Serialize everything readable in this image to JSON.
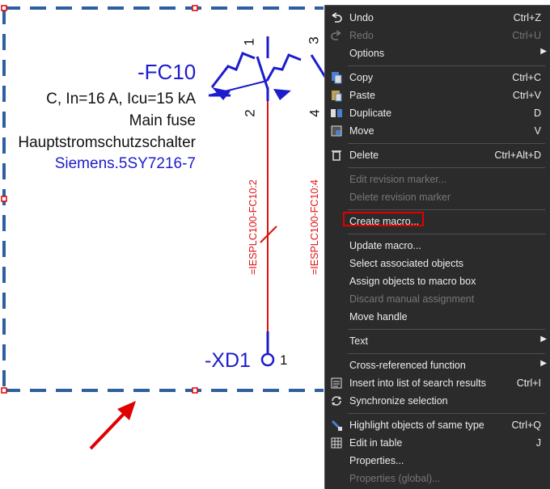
{
  "schematic": {
    "device_tag": "-FC10",
    "properties": [
      "C, In=16 A, Icu=15 kA",
      "Main fuse",
      "Hauptstromschutzschalter"
    ],
    "part_number": "Siemens.5SY7216-7",
    "terminal_tag": "-XD1",
    "terminal_pin": "1",
    "pins": {
      "p1": "1",
      "p2": "2",
      "p3": "3",
      "p4": "4"
    },
    "cross_ref_1": "=IESPLC100-FC10:2",
    "cross_ref_2": "=IESPLC100-FC10:4",
    "colors": {
      "symbol": "#1c1ccd",
      "wire": "#e01010",
      "box_dash": "#2e5f9e"
    }
  },
  "context_menu": {
    "items": [
      {
        "label": "Undo",
        "shortcut": "Ctrl+Z",
        "icon": "undo-icon"
      },
      {
        "label": "Redo",
        "shortcut": "Ctrl+U",
        "icon": "redo-icon",
        "disabled": true
      },
      {
        "label": "Options",
        "submenu": true
      },
      {
        "label": "Copy",
        "shortcut": "Ctrl+C",
        "icon": "copy-icon"
      },
      {
        "label": "Paste",
        "shortcut": "Ctrl+V",
        "icon": "paste-icon"
      },
      {
        "label": "Duplicate",
        "shortcut": "D",
        "icon": "duplicate-icon"
      },
      {
        "label": "Move",
        "shortcut": "V",
        "icon": "move-icon"
      },
      {
        "label": "Delete",
        "shortcut": "Ctrl+Alt+D",
        "icon": "trash-icon"
      },
      {
        "label": "Edit revision marker...",
        "disabled": true
      },
      {
        "label": "Delete revision marker",
        "disabled": true
      },
      {
        "label": "Create macro...",
        "highlighted": true
      },
      {
        "label": "Update macro..."
      },
      {
        "label": "Select associated objects"
      },
      {
        "label": "Assign objects to macro box"
      },
      {
        "label": "Discard manual assignment",
        "disabled": true
      },
      {
        "label": "Move handle"
      },
      {
        "label": "Text",
        "submenu": true
      },
      {
        "label": "Cross-referenced function",
        "submenu": true
      },
      {
        "label": "Insert into list of search results",
        "shortcut": "Ctrl+I",
        "icon": "search-results-icon"
      },
      {
        "label": "Synchronize selection",
        "icon": "sync-icon"
      },
      {
        "label": "Highlight objects of same type",
        "shortcut": "Ctrl+Q",
        "icon": "highlight-icon"
      },
      {
        "label": "Edit in table",
        "shortcut": "J",
        "icon": "table-icon"
      },
      {
        "label": "Properties..."
      },
      {
        "label": "Properties (global)...",
        "disabled": true
      }
    ]
  }
}
